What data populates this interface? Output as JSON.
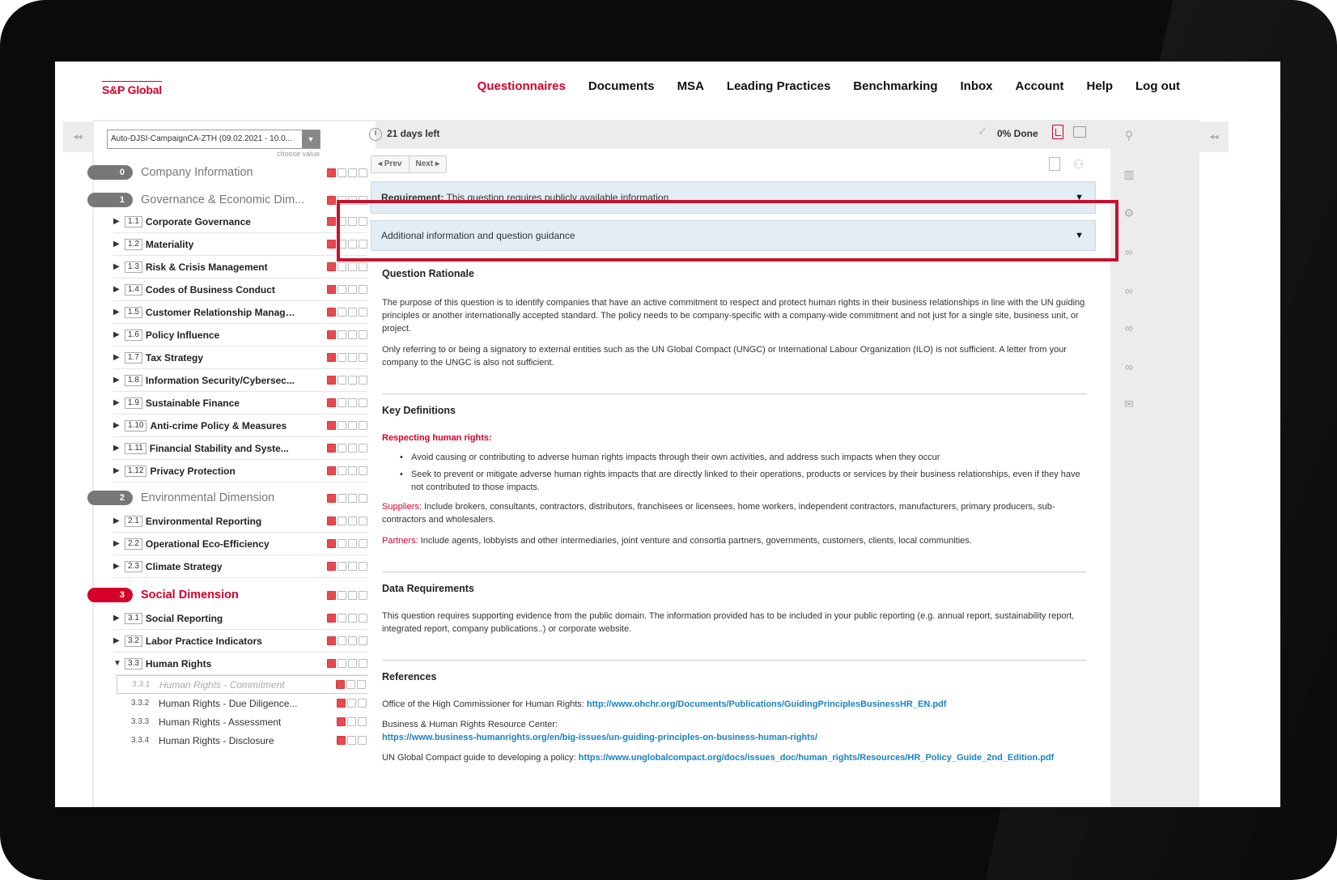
{
  "header": {
    "logo": "S&P Global",
    "nav": [
      "Questionnaires",
      "Documents",
      "MSA",
      "Leading Practices",
      "Benchmarking",
      "Inbox",
      "Account",
      "Help",
      "Log out"
    ]
  },
  "sidebar": {
    "select_value": "Auto-DJSI-CampaignCA-ZTH (09.02.2021 - 10.0...",
    "select_hint": "choose value",
    "dimensions": [
      {
        "num": "0",
        "label": "Company Information"
      },
      {
        "num": "1",
        "label": "Governance & Economic Dim..."
      },
      {
        "num": "2",
        "label": "Environmental Dimension"
      },
      {
        "num": "3",
        "label": "Social Dimension"
      }
    ],
    "criteria": [
      {
        "num": "1.1",
        "label": "Corporate Governance"
      },
      {
        "num": "1.2",
        "label": "Materiality"
      },
      {
        "num": "1.3",
        "label": "Risk & Crisis Management"
      },
      {
        "num": "1.4",
        "label": "Codes of Business Conduct"
      },
      {
        "num": "1.5",
        "label": "Customer Relationship Manage..."
      },
      {
        "num": "1.6",
        "label": "Policy Influence"
      },
      {
        "num": "1.7",
        "label": "Tax Strategy"
      },
      {
        "num": "1.8",
        "label": "Information Security/Cybersec..."
      },
      {
        "num": "1.9",
        "label": "Sustainable Finance"
      },
      {
        "num": "1.10",
        "label": "Anti-crime Policy & Measures"
      },
      {
        "num": "1.11",
        "label": "Financial Stability and Syste..."
      },
      {
        "num": "1.12",
        "label": "Privacy Protection"
      },
      {
        "num": "2.1",
        "label": "Environmental Reporting"
      },
      {
        "num": "2.2",
        "label": "Operational Eco-Efficiency"
      },
      {
        "num": "2.3",
        "label": "Climate Strategy"
      },
      {
        "num": "3.1",
        "label": "Social Reporting"
      },
      {
        "num": "3.2",
        "label": "Labor Practice Indicators"
      },
      {
        "num": "3.3",
        "label": "Human Rights"
      }
    ],
    "questions": [
      {
        "num": "3.3.1",
        "label": "Human Rights - Commitment"
      },
      {
        "num": "3.3.2",
        "label": "Human Rights - Due Diligence..."
      },
      {
        "num": "3.3.3",
        "label": "Human Rights - Assessment"
      },
      {
        "num": "3.3.4",
        "label": "Human Rights - Disclosure"
      }
    ]
  },
  "topbar": {
    "days_left": "21 days left",
    "done": "0% Done"
  },
  "content": {
    "prev": "Prev",
    "next": "Next",
    "requirement_label": "Requirement:",
    "requirement_text": "This question requires publicly available information",
    "guidance_bar": "Additional information and question guidance",
    "rationale_title": "Question Rationale",
    "rationale_p1": "The purpose of this question is to identify companies that have an active commitment to respect and protect human rights in their business relationships in line with the UN guiding principles or another internationally accepted standard. The policy needs to be company-specific with a company-wide commitment and not just for a single site, business unit, or project.",
    "rationale_p2": "Only referring to or being a signatory to external entities such as the UN Global Compact (UNGC) or International Labour Organization (ILO) is not sufficient. A letter from your company to the UNGC is also not sufficient.",
    "defs_title": "Key Definitions",
    "defs_respecting": "Respecting human rights:",
    "defs_bullets": [
      "Avoid causing or contributing to adverse human rights impacts through their own activities, and address such impacts when they occur",
      "Seek to prevent or mitigate adverse human rights impacts that are directly linked to their operations, products or services by their business relationships, even if they have not contributed to those impacts."
    ],
    "suppliers_label": "Suppliers:",
    "suppliers_text": "Include brokers, consultants, contractors, distributors, franchisees or licensees, home workers, independent contractors, manufacturers, primary producers, sub-contractors and wholesalers.",
    "partners_label": "Partners:",
    "partners_text": "Include agents, lobbyists and other intermediaries, joint venture and consortia partners, governments, customers, clients, local communities.",
    "data_title": "Data Requirements",
    "data_text": "This question requires supporting evidence from the public domain. The information provided has to be included in your public reporting (e.g. annual report, sustainability report, integrated report, company publications..) or corporate website.",
    "refs_title": "References",
    "ref1_label": "Office of the High Commissioner for Human Rights:",
    "ref1_link": "http://www.ohchr.org/Documents/Publications/GuidingPrinciplesBusinessHR_EN.pdf",
    "ref2_label": "Business & Human Rights Resource Center:",
    "ref2_link": "https://www.business-humanrights.org/en/big-issues/un-guiding-principles-on-business-human-rights/",
    "ref3_label": "UN Global Compact guide to developing a policy:",
    "ref3_link": "https://www.unglobalcompact.org/docs/issues_doc/human_rights/Resources/HR_Policy_Guide_2nd_Edition.pdf"
  },
  "icons": [
    "clock-icon",
    "check-icon",
    "pdf-icon",
    "flag-icon",
    "document-icon",
    "user-check-icon",
    "user-icon",
    "building-icon",
    "gear-icon",
    "link-icon",
    "mail-icon"
  ],
  "colors": {
    "accent": "#d6002a",
    "link": "#1a82c3",
    "guidance_bar": "#e3edf5",
    "highlight_box": "#c8102e"
  }
}
